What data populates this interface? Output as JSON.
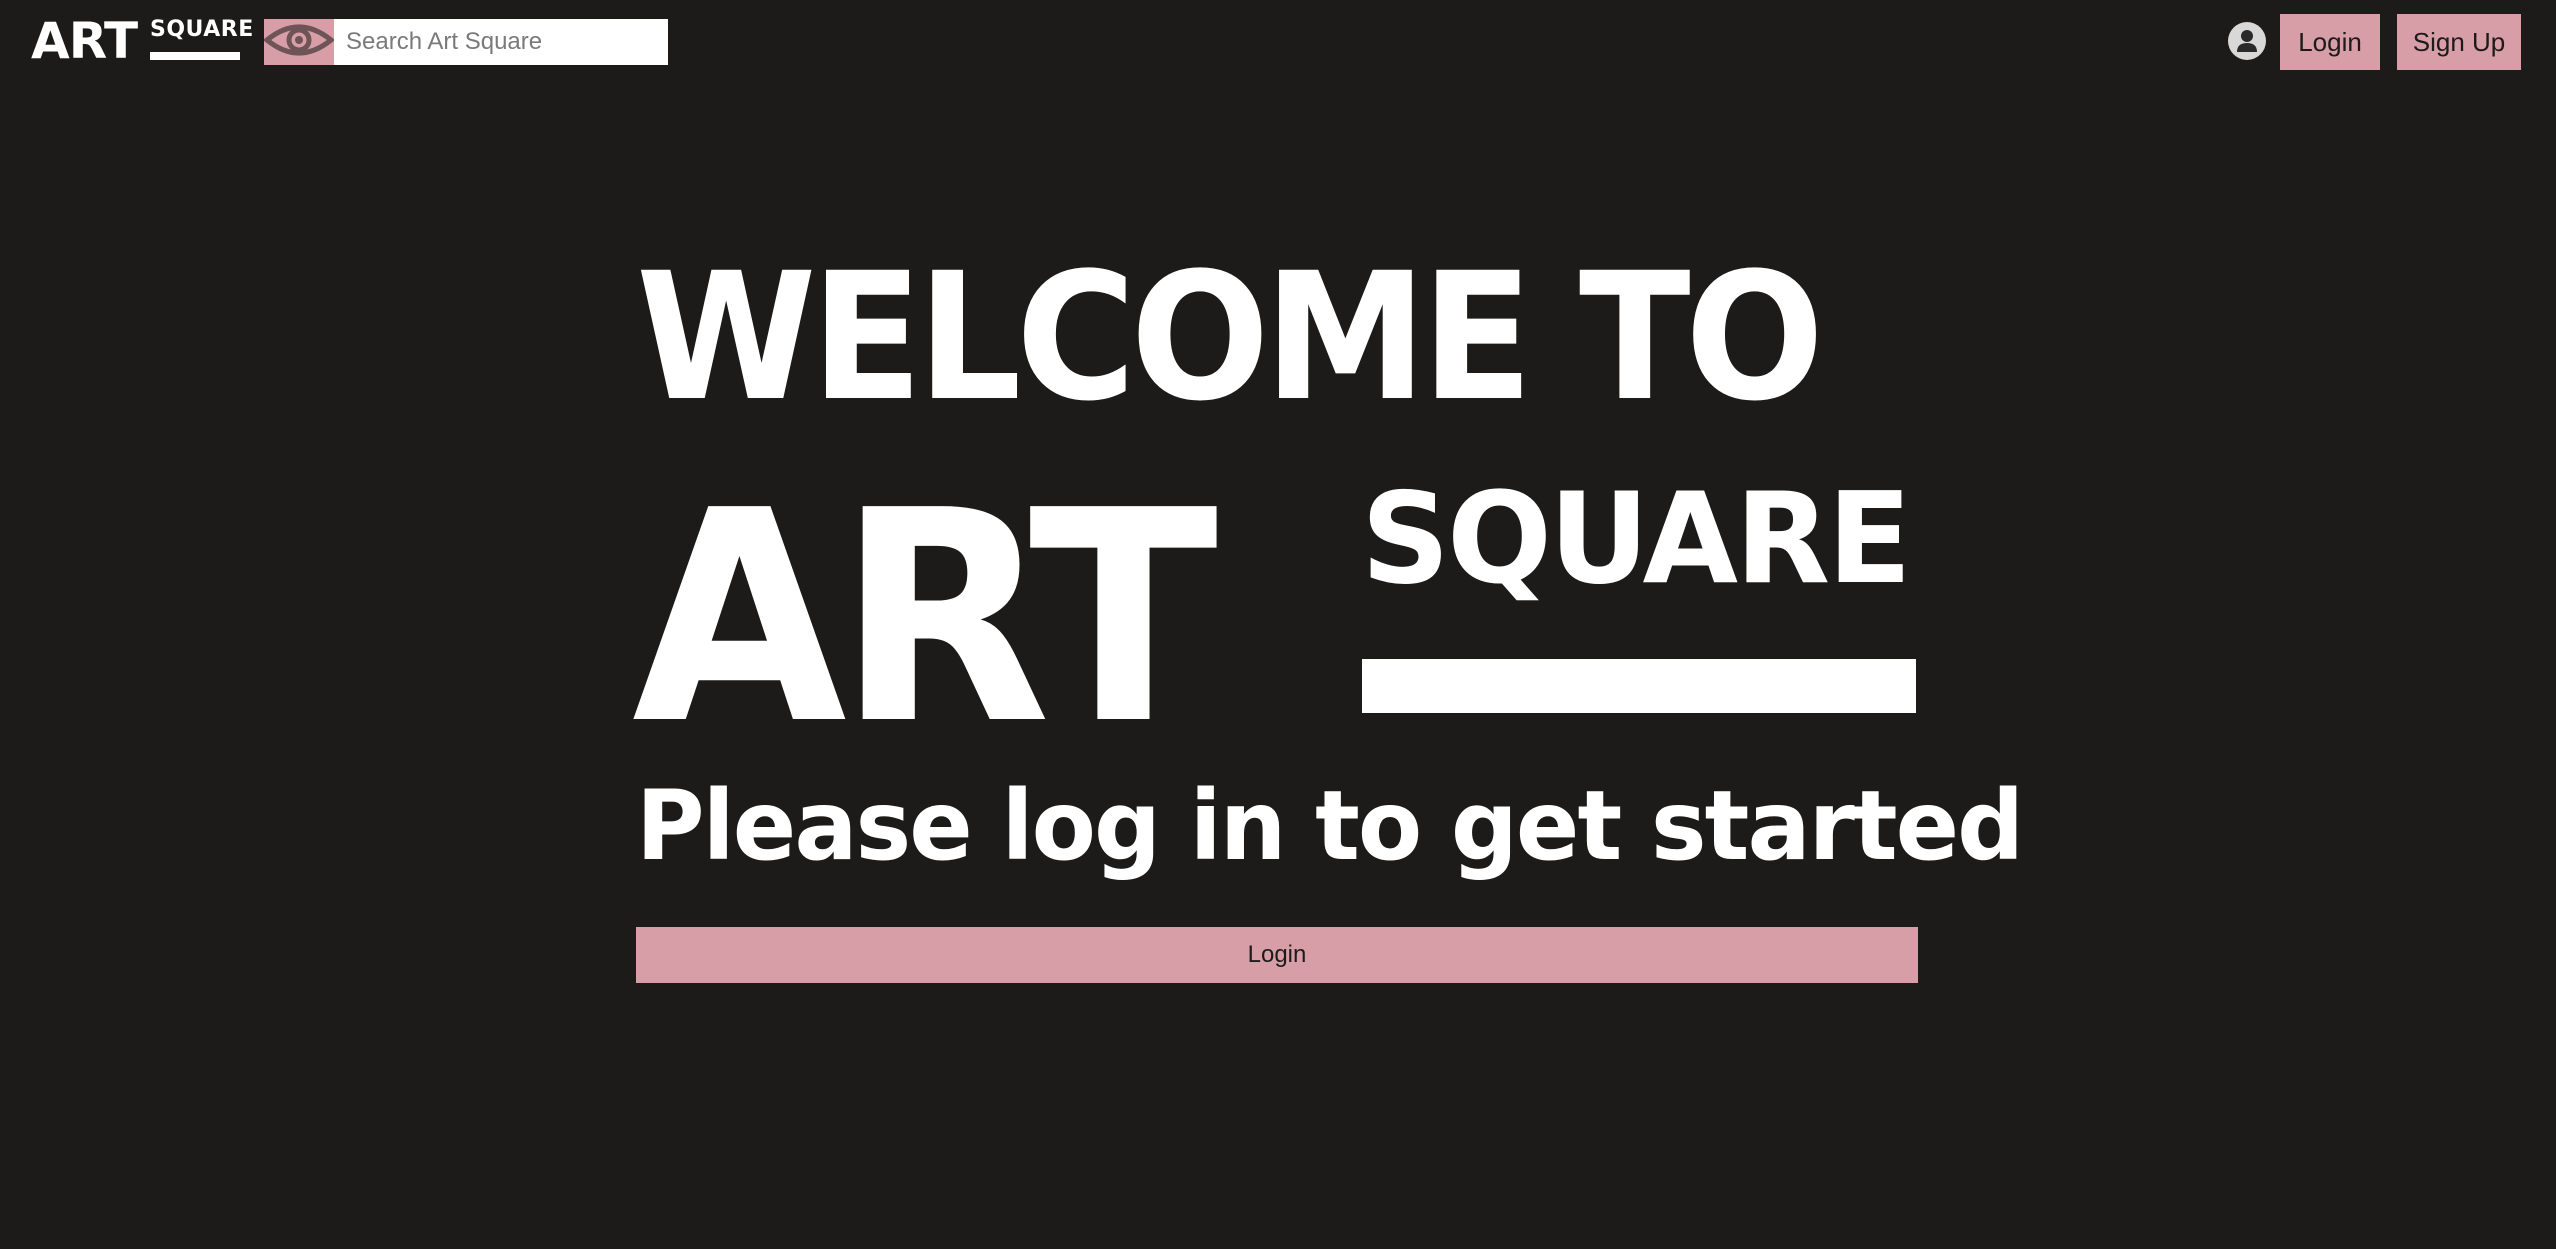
{
  "colors": {
    "background": "#1c1b19",
    "accent": "#d89ea7",
    "text": "#ffffff",
    "button_text": "#1c1b19"
  },
  "navbar": {
    "brand": {
      "art": "ART",
      "square": "SQUARE"
    },
    "search": {
      "icon": "eye-icon",
      "placeholder": "Search Art Square",
      "value": ""
    },
    "user_icon": "user-avatar-icon",
    "login_label": "Login",
    "signup_label": "Sign Up"
  },
  "hero": {
    "welcome": "WELCOME TO",
    "art": "ART",
    "square": "SQUARE",
    "tagline": "Please log in to get started",
    "login_label": "Login"
  }
}
